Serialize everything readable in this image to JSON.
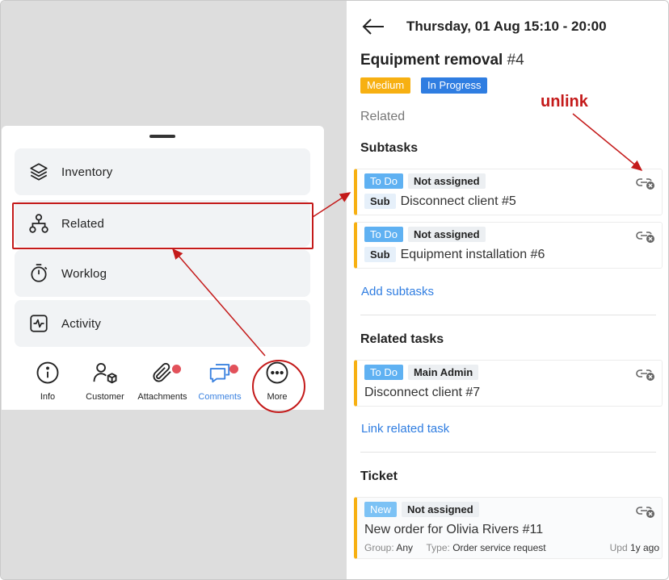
{
  "menu": {
    "items": [
      {
        "label": "Inventory",
        "icon": "layers-icon"
      },
      {
        "label": "Related",
        "icon": "hierarchy-icon"
      },
      {
        "label": "Worklog",
        "icon": "stopwatch-icon"
      },
      {
        "label": "Activity",
        "icon": "activity-icon"
      }
    ]
  },
  "bottom_nav": {
    "items": [
      {
        "label": "Info",
        "icon": "info-icon"
      },
      {
        "label": "Customer",
        "icon": "customer-icon"
      },
      {
        "label": "Attachments",
        "icon": "paperclip-icon"
      },
      {
        "label": "Comments",
        "icon": "comments-icon"
      },
      {
        "label": "More",
        "icon": "more-icon"
      }
    ]
  },
  "task": {
    "datetime": "Thursday, 01 Aug 15:10 - 20:00",
    "title": "Equipment removal",
    "number": "#4",
    "priority": "Medium",
    "status": "In Progress",
    "section": "Related"
  },
  "subtasks": {
    "heading": "Subtasks",
    "items": [
      {
        "status": "To Do",
        "assignee": "Not assigned",
        "type": "Sub",
        "name": "Disconnect client #5"
      },
      {
        "status": "To Do",
        "assignee": "Not assigned",
        "type": "Sub",
        "name": "Equipment installation #6"
      }
    ],
    "add_label": "Add subtasks"
  },
  "related_tasks": {
    "heading": "Related tasks",
    "items": [
      {
        "status": "To Do",
        "assignee": "Main Admin",
        "name": "Disconnect client #7"
      }
    ],
    "link_label": "Link related task"
  },
  "ticket": {
    "heading": "Ticket",
    "status": "New",
    "assignee": "Not assigned",
    "name": "New order for Olivia Rivers #11",
    "group_key": "Group:",
    "group_val": "Any",
    "type_key": "Type:",
    "type_val": "Order service request",
    "upd_key": "Upd",
    "upd_val": "1y ago"
  },
  "annotation": {
    "label": "unlink"
  },
  "colors": {
    "accent": "#2f7de1",
    "highlight": "#c41a1a",
    "warning": "#f7b012"
  }
}
